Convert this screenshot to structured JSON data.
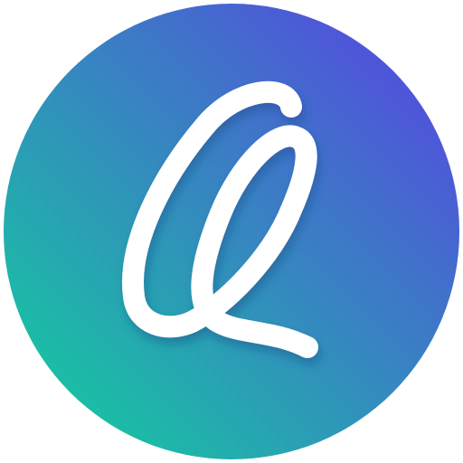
{
  "logo": {
    "icon_name": "script-q-logo-icon",
    "gradient_start": "#10D39A",
    "gradient_end": "#5A3FE4",
    "glyph_color": "#FFFFFF",
    "shadow_color": "#1E4E86"
  }
}
